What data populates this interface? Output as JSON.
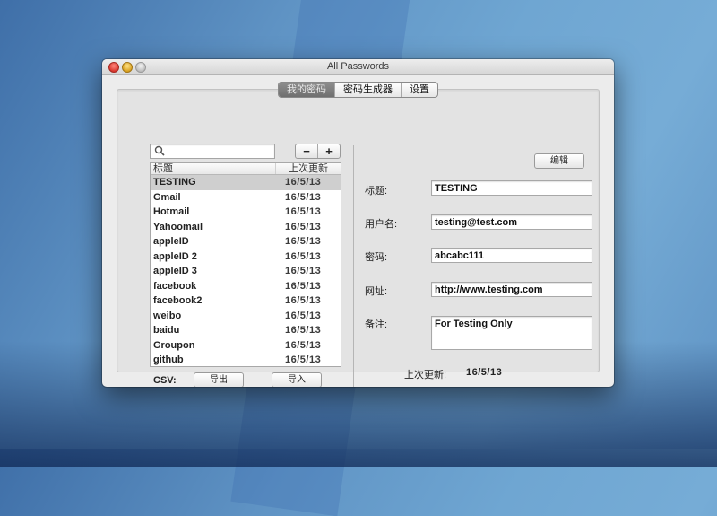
{
  "window": {
    "title": "All Passwords"
  },
  "tabs": [
    {
      "label": "我的密码",
      "active": true
    },
    {
      "label": "密码生成器",
      "active": false
    },
    {
      "label": "设置",
      "active": false
    }
  ],
  "search": {
    "value": "",
    "placeholder": "",
    "icon": "magnifier-icon"
  },
  "list_controls": {
    "remove_label": "−",
    "add_label": "+"
  },
  "list": {
    "columns": [
      "标题",
      "上次更新"
    ],
    "rows": [
      {
        "title": "TESTING",
        "date": "16/5/13",
        "selected": true
      },
      {
        "title": "Gmail",
        "date": "16/5/13"
      },
      {
        "title": "Hotmail",
        "date": "16/5/13"
      },
      {
        "title": "Yahoomail",
        "date": "16/5/13"
      },
      {
        "title": "appleID",
        "date": "16/5/13"
      },
      {
        "title": "appleID 2",
        "date": "16/5/13"
      },
      {
        "title": "appleID 3",
        "date": "16/5/13"
      },
      {
        "title": "facebook",
        "date": "16/5/13"
      },
      {
        "title": "facebook2",
        "date": "16/5/13"
      },
      {
        "title": "weibo",
        "date": "16/5/13"
      },
      {
        "title": "baidu",
        "date": "16/5/13"
      },
      {
        "title": "Groupon",
        "date": "16/5/13"
      },
      {
        "title": "github",
        "date": "16/5/13"
      }
    ]
  },
  "csv": {
    "label": "CSV:",
    "export_label": "导出",
    "import_label": "导入"
  },
  "detail": {
    "edit_label": "编辑",
    "title_label": "标题:",
    "title_value": "TESTING",
    "username_label": "用户名:",
    "username_value": "testing@test.com",
    "password_label": "密码:",
    "password_value": "abcabc111",
    "url_label": "网址:",
    "url_value": "http://www.testing.com",
    "note_label": "备注:",
    "note_value": "For Testing Only",
    "updated_label": "上次更新:",
    "updated_value": "16/5/13"
  }
}
